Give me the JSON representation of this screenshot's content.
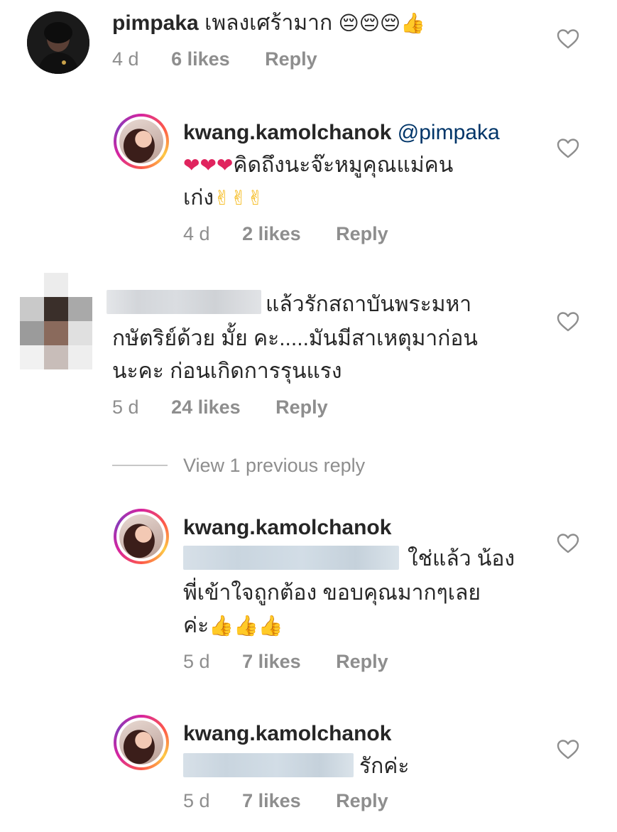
{
  "comments": [
    {
      "username": "pimpaka",
      "text": "เพลงเศร้ามาก",
      "emojis": "😔😔😔👍",
      "time": "4 d",
      "likes": "6 likes",
      "reply": "Reply"
    },
    {
      "username": "kwang.kamolchanok",
      "mention": "@pimpaka",
      "line1_emojis": "❤❤❤",
      "line1": "คิดถึงนะจ๊ะหมูคุณแม่คน",
      "line2": "เก่ง",
      "line2_emojis": "✌✌✌",
      "time": "4 d",
      "likes": "2 likes",
      "reply": "Reply"
    },
    {
      "line1": "แล้วรักสถาบันพระมหา",
      "line2": "กษัตริย์ด้วย มั้ย คะ.....มันมีสาเหตุมาก่อน",
      "line3": "นะคะ ก่อนเกิดการรุนแรง",
      "time": "5 d",
      "likes": "24 likes",
      "reply": "Reply"
    },
    {
      "view_previous": "View 1 previous reply"
    },
    {
      "username": "kwang.kamolchanok",
      "line1": "ใช่แล้ว น้อง",
      "line2": "พี่เข้าใจถูกต้อง ขอบคุณมากๆเลย",
      "line3": "ค่ะ",
      "line3_emojis": "👍👍👍",
      "time": "5 d",
      "likes": "7 likes",
      "reply": "Reply"
    },
    {
      "username": "kwang.kamolchanok",
      "line1": "รักค่ะ",
      "time": "5 d",
      "likes": "7 likes",
      "reply": "Reply"
    }
  ],
  "icons": {
    "like": "heart-outline-icon"
  },
  "colors": {
    "text": "#262626",
    "meta": "#8e8e8e",
    "mention": "#003569"
  }
}
